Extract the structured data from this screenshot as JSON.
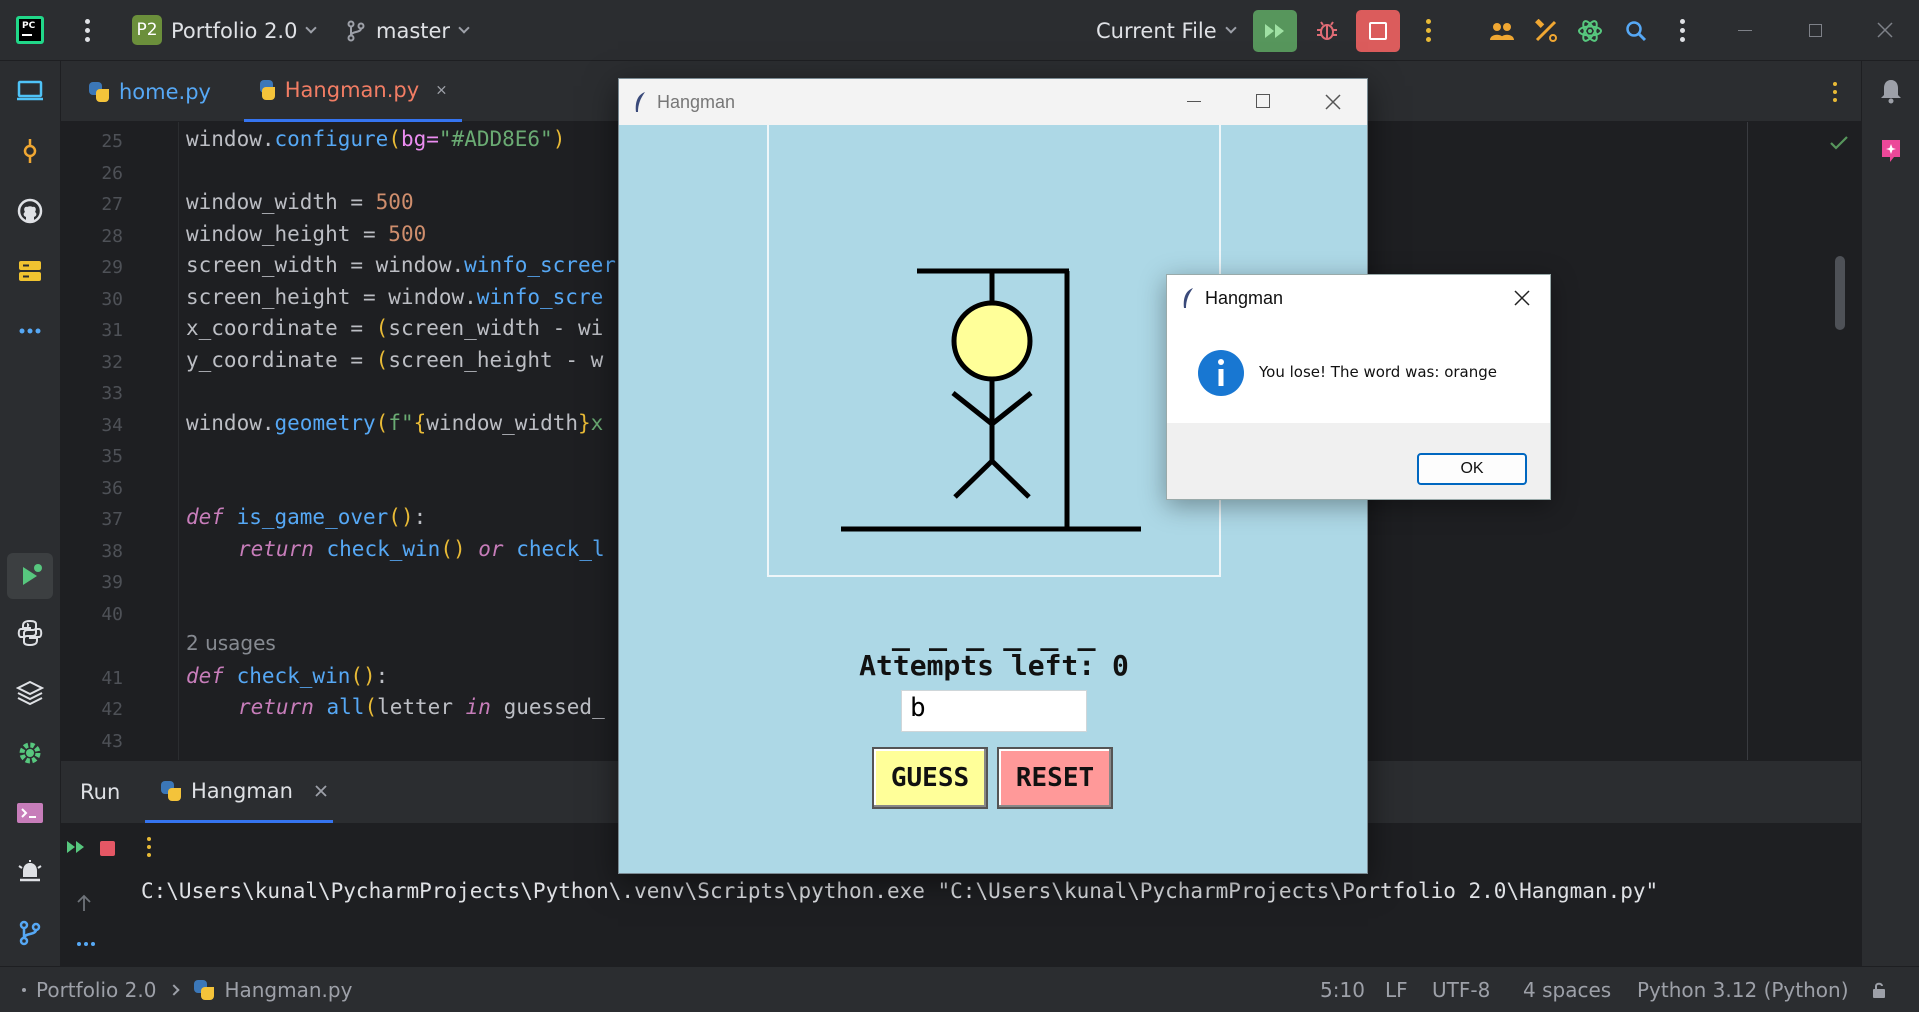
{
  "ide": {
    "project_badge": "P2",
    "project_name": "Portfolio 2.0",
    "branch": "master",
    "run_config": "Current File",
    "logo_text": "PC"
  },
  "tabs": [
    {
      "label": "home.py",
      "active": false
    },
    {
      "label": "Hangman.py",
      "active": true
    }
  ],
  "editor": {
    "line_numbers": [
      "25",
      "26",
      "27",
      "28",
      "29",
      "30",
      "31",
      "32",
      "33",
      "34",
      "35",
      "36",
      "37",
      "38",
      "39",
      "40",
      "41",
      "42",
      "43"
    ],
    "usages_hint": "2 usages",
    "lines": {
      "l25": [
        "window.",
        "configure",
        "(",
        "bg=",
        "\"#ADD8E6\"",
        ")"
      ],
      "l27": [
        "window_width = ",
        "500"
      ],
      "l28": [
        "window_height = ",
        "500"
      ],
      "l29": [
        "screen_width = window.",
        "winfo_screer"
      ],
      "l30": [
        "screen_height = window.",
        "winfo_scre"
      ],
      "l31": [
        "x_coordinate = ",
        "(",
        "screen_width - wi"
      ],
      "l32": [
        "y_coordinate = ",
        "(",
        "screen_height - w"
      ],
      "l34": [
        "window.",
        "geometry",
        "(",
        "f\"",
        "{",
        "window_width",
        "}",
        "x"
      ],
      "l37": [
        "def ",
        "is_game_over",
        "()",
        ":"
      ],
      "l38": [
        "return ",
        "check_win",
        "()",
        " or ",
        "check_l"
      ],
      "l41": [
        "def ",
        "check_win",
        "()",
        ":"
      ],
      "l42": [
        "return ",
        "all",
        "(",
        "letter ",
        "in ",
        "guessed_"
      ]
    }
  },
  "run_panel": {
    "title": "Run",
    "tab_label": "Hangman",
    "console_line": "C:\\Users\\kunal\\PycharmProjects\\Python\\.venv\\Scripts\\python.exe \"C:\\Users\\kunal\\PycharmProjects\\Portfolio 2.0\\Hangman.py\""
  },
  "statusbar": {
    "project": "Portfolio 2.0",
    "file": "Hangman.py",
    "position": "5:10",
    "line_sep": "LF",
    "encoding": "UTF-8",
    "indent": "4 spaces",
    "interpreter": "Python 3.12 (Python)"
  },
  "hangman_window": {
    "title": "Hangman",
    "blanks": "_ _ _ _ _ _",
    "attempts": "Attempts left: 0",
    "input_value": "b",
    "guess_label": "GUESS",
    "reset_label": "RESET",
    "bg_color": "#ADD8E6",
    "head_color": "#FFFF99",
    "guess_color": "#FFFF99",
    "reset_color": "#FF9999"
  },
  "message_box": {
    "title": "Hangman",
    "message": "You lose! The word was: orange",
    "ok_label": "OK"
  }
}
